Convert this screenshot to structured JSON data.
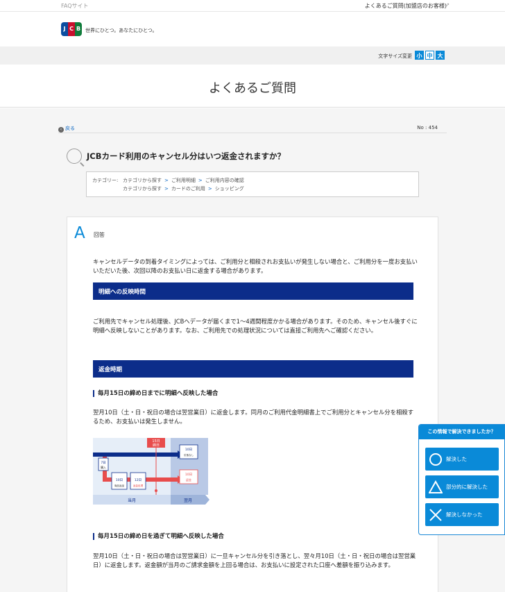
{
  "topbar": {
    "site": "FAQサイト",
    "merchant_link": "よくあるご質問(加盟店のお客様)",
    "ext_icon": "external-link-icon"
  },
  "header": {
    "logo_letters": [
      "J",
      "C",
      "B"
    ],
    "tagline": "世界にひとつ。あなたにひとつ。"
  },
  "font_size": {
    "label": "文字サイズ変更",
    "small": "小",
    "medium": "中",
    "large": "大"
  },
  "page_title": "よくあるご質問",
  "nav": {
    "back": "戻る",
    "number": "No : 454"
  },
  "question": "JCBカード利用のキャンセル分はいつ返金されますか？",
  "categories": {
    "label": "カテゴリー:",
    "path1": [
      "カテゴリから探す",
      "ご利用明細",
      "ご利用内容の確認"
    ],
    "path2": [
      "カテゴリから探す",
      "カードのご利用",
      "ショッピング"
    ]
  },
  "answer": {
    "mark": "A",
    "label": "回答",
    "intro": "キャンセルデータの到着タイミングによっては、ご利用分と相殺されお支払いが発生しない場合と、ご利用分を一度お支払いいただいた後、次回以降のお支払い日に返金する場合があります。",
    "section1_title": "明細への反映時間",
    "section1_text": "ご利用先でキャンセル処理後、JCBへデータが届くまで1〜4週間程度かかる場合があります。そのため、キャンセル後すぐに明細へ反映しないことがあります。なお、ご利用先での処理状況については直接ご利用先へご確認ください。",
    "section2_title": "返金時期",
    "sub1_title": "毎月15日の締め日までに明細へ反映した場合",
    "sub1_text": "翌月10日（土・日・祝日の場合は翌営業日）に返金します。同月のご利用代金明細書上でご利用分とキャンセル分を相殺するため、お支払いは発生しません。",
    "sub2_title": "毎月15日の締め日を過ぎて明細へ反映した場合",
    "sub2_text": "翌月10日（土・日・祝日の場合は翌営業日）に一旦キャンセル分を引き落とし、翌々月10日（土・日・祝日の場合は翌営業日）に返金します。返金額が当月のご請求金額を上回る場合は、お支払いに設定された口座へ差額を振り込みます。"
  },
  "diagram": {
    "d15": "15日",
    "shime": "締日",
    "d7": "7日",
    "purchase": "購入",
    "d10a": "10日",
    "product_return": "商品返品",
    "d12": "12日",
    "cancel": "返金処理",
    "d10b": "10日",
    "debit_none": "引落なし",
    "d10c": "10日",
    "refund": "返金",
    "this_month": "当月",
    "next_month": "翌月"
  },
  "feedback": {
    "title": "この情報で解決できましたか？",
    "solved": "解決した",
    "partial": "部分的に解決した",
    "unsolved": "解決しなかった"
  }
}
